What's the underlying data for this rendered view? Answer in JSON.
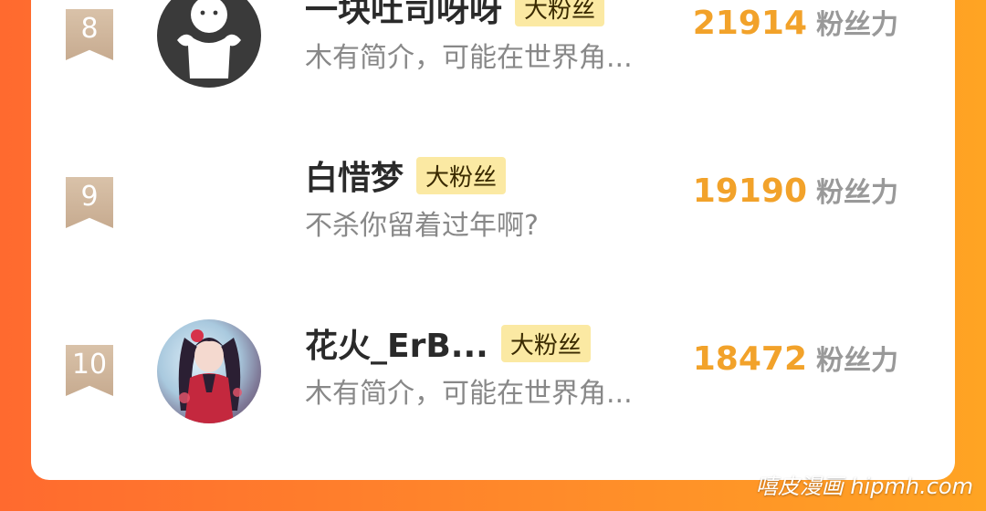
{
  "rows": [
    {
      "rank": "8",
      "name": "一块吐司呀呀",
      "badge": "大粉丝",
      "intro": "木有简介，可能在世界角...",
      "score": "21914",
      "score_unit": "粉丝力",
      "avatar": "default-avatar-icon"
    },
    {
      "rank": "9",
      "name": "白惜梦",
      "badge": "大粉丝",
      "intro": "不杀你留着过年啊?",
      "score": "19190",
      "score_unit": "粉丝力",
      "avatar": "none"
    },
    {
      "rank": "10",
      "name": "花火_ErB...",
      "badge": "大粉丝",
      "intro": "木有简介，可能在世界角...",
      "score": "18472",
      "score_unit": "粉丝力",
      "avatar": "anime-avatar"
    }
  ],
  "watermark": "嘻皮漫画 hipmh.com",
  "colors": {
    "score": "#f2a22a",
    "badge_bg": "#fbe9a3",
    "rank_ribbon": "#c7ab90",
    "background_start": "#ff6a2f",
    "background_end": "#ffa423"
  }
}
